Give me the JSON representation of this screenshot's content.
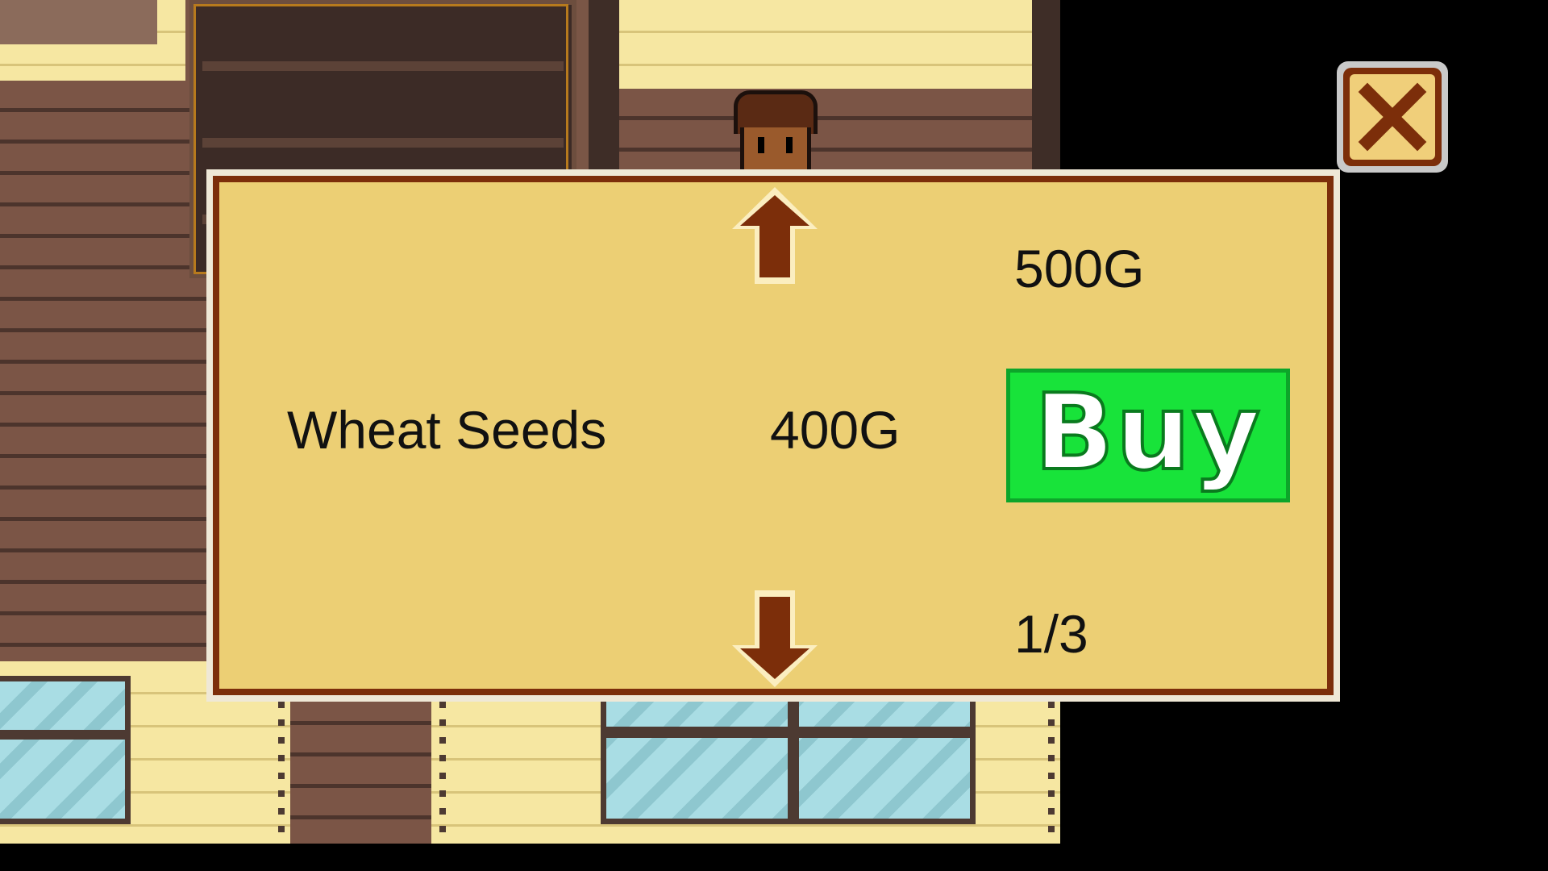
{
  "shop": {
    "gold": "500G",
    "item": {
      "name": "Wheat Seeds",
      "price": "400G"
    },
    "buy_label": "Buy",
    "page": "1/3"
  },
  "icons": {
    "close": "close-x-icon",
    "up": "arrow-up-icon",
    "down": "arrow-down-icon"
  },
  "colors": {
    "panel_bg": "#eccf74",
    "panel_border": "#7c2e0a",
    "buy_green": "#18e33a",
    "arrow_brown": "#7c2e0a"
  }
}
